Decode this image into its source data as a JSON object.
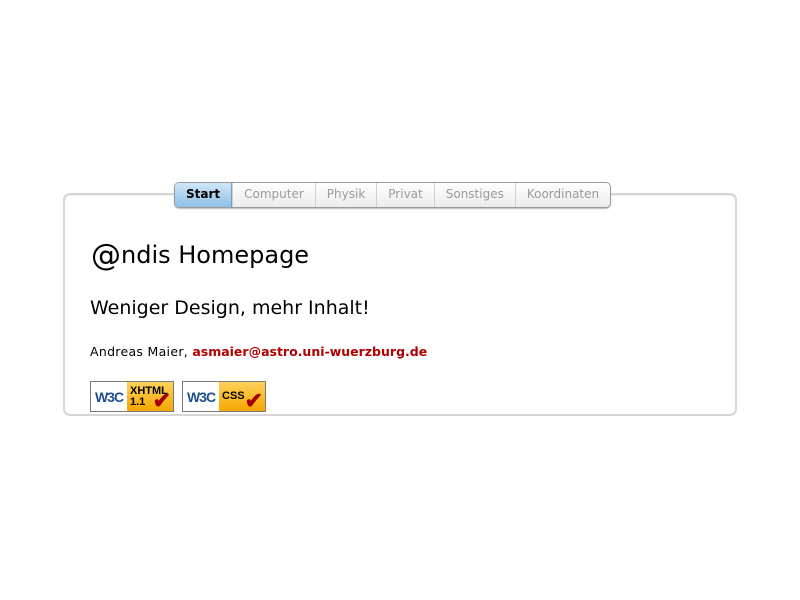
{
  "nav": {
    "tabs": [
      {
        "label": "Start",
        "active": true
      },
      {
        "label": "Computer",
        "active": false
      },
      {
        "label": "Physik",
        "active": false
      },
      {
        "label": "Privat",
        "active": false
      },
      {
        "label": "Sonstiges",
        "active": false
      },
      {
        "label": "Koordinaten",
        "active": false
      }
    ]
  },
  "main": {
    "title_at": "@",
    "title_rest": "ndis Homepage",
    "subtitle": "Weniger Design, mehr Inhalt!",
    "author_name": "Andreas Maier,",
    "author_email": "asmaier@astro.uni-wuerzburg.de"
  },
  "badges": {
    "xhtml": {
      "w3c": "W3C",
      "line1": "XHTML",
      "line2": "1.1"
    },
    "css": {
      "w3c": "W3C",
      "line1": "CSS"
    }
  },
  "colors": {
    "accent": "#b00000",
    "tab_active": "#8fc0e6",
    "badge_gold": "#f6a600"
  }
}
